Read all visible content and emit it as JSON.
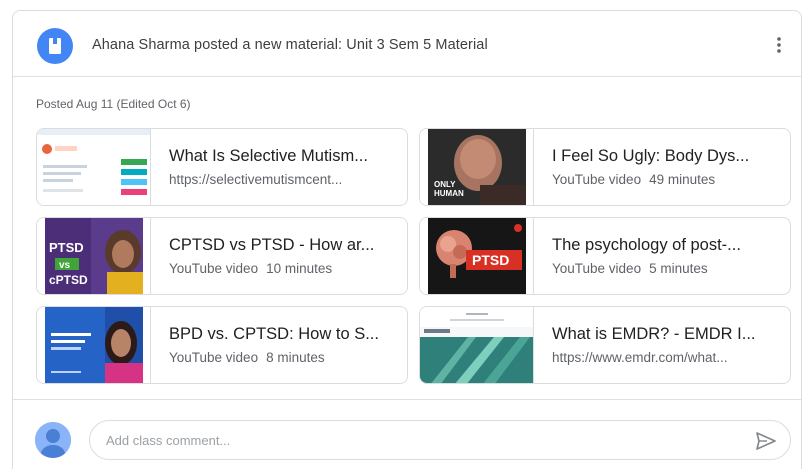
{
  "post": {
    "header_title": "Ahana Sharma posted a new material: Unit 3 Sem 5 Material",
    "posted_text": "Posted Aug 11 (Edited Oct 6)"
  },
  "attachments": [
    {
      "title": "What Is Selective Mutism...",
      "source": "https://selectivemutismcent...",
      "duration": "",
      "thumb": "website-screenshot"
    },
    {
      "title": "I Feel So Ugly: Body Dys...",
      "source": "YouTube video",
      "duration": "49 minutes",
      "thumb": "video-face"
    },
    {
      "title": "CPTSD vs PTSD - How ar...",
      "source": "YouTube video",
      "duration": "10 minutes",
      "thumb": "video-ptsd-vs-cptsd",
      "thumb_text": [
        "PTSD",
        "vs",
        "cPTSD"
      ]
    },
    {
      "title": "The psychology of post-...",
      "source": "YouTube video",
      "duration": "5 minutes",
      "thumb": "video-ptsd-brain",
      "thumb_text": [
        "PTSD"
      ]
    },
    {
      "title": "BPD vs. CPTSD: How to S...",
      "source": "YouTube video",
      "duration": "8 minutes",
      "thumb": "video-bpd-cptsd"
    },
    {
      "title": "What is EMDR? - EMDR I...",
      "source": "https://www.emdr.com/what...",
      "duration": "",
      "thumb": "website-emdr"
    }
  ],
  "comment": {
    "placeholder": "Add class comment..."
  },
  "icons": {
    "material": "material-icon",
    "more": "more-vert-icon",
    "avatar": "avatar-icon",
    "send": "send-icon"
  },
  "colors": {
    "accent": "#4285f4",
    "border": "#dadce0",
    "subtext": "#5f6368",
    "ptsd_red": "#d93025"
  }
}
